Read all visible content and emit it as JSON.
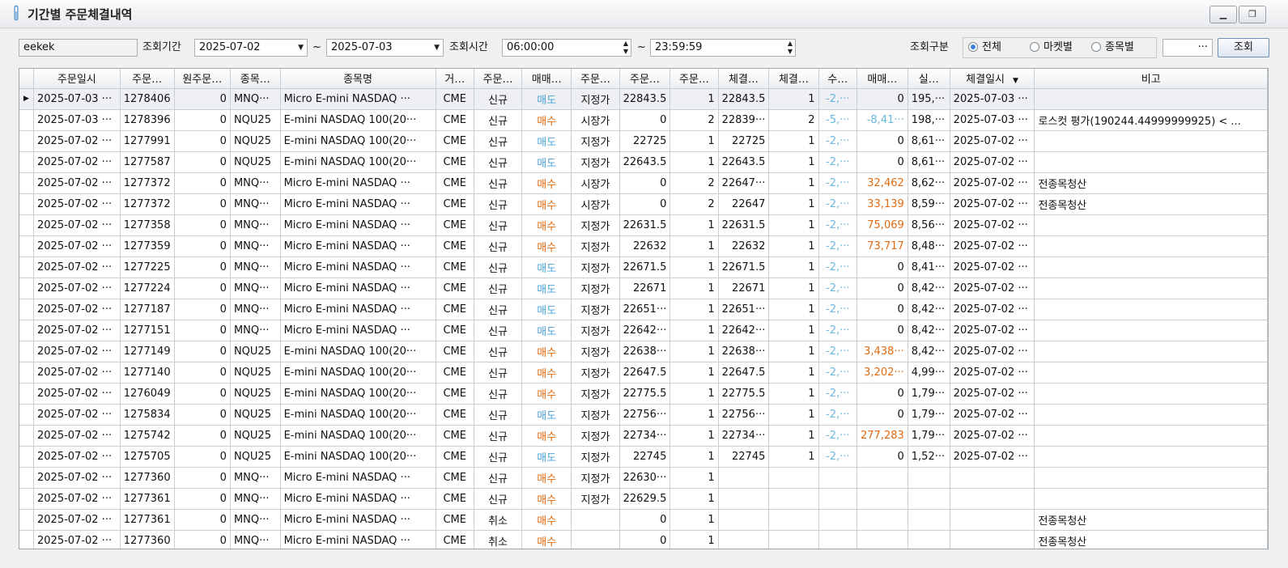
{
  "window": {
    "title": "기간별 주문체결내역",
    "minimize": "▁",
    "restore": "❐"
  },
  "toolbar": {
    "account": "eekek",
    "label_period": "조회기간",
    "date_from": "2025-07-02",
    "tilde": "~",
    "date_to": "2025-07-03",
    "label_time": "조회시간",
    "time_from": "06:00:00",
    "time_to": "23:59:59",
    "label_type": "조회구분",
    "radios": [
      {
        "label": "전체",
        "selected": true
      },
      {
        "label": "마켓별",
        "selected": false
      },
      {
        "label": "종목별",
        "selected": false
      }
    ],
    "symbol_value": "···",
    "search_label": "조회"
  },
  "grid": {
    "columns": [
      "주문일시",
      "주문…",
      "원주문…",
      "종목…",
      "종목명",
      "거…",
      "주문…",
      "매매…",
      "주문…",
      "주문…",
      "주문…",
      "체결…",
      "체결…",
      "수…",
      "매매…",
      "실…",
      "체결일시",
      "비고"
    ],
    "sort_indicator": "▼",
    "row_marker": "▶",
    "colors": {
      "sell": "#4aa3d8",
      "buy": "#e06a12",
      "pnl_pos": "#e06a12",
      "pnl_neg": "#6ab6dc"
    },
    "rows": [
      [
        "2025-07-03 ···",
        "1278406",
        "0",
        "MNQ···",
        "Micro E-mini NASDAQ ···",
        "CME",
        "신규",
        "매도",
        "지정가",
        "22843.5",
        "1",
        "22843.5",
        "1",
        "-2,···",
        "0",
        "195,···",
        "2025-07-03 ···",
        ""
      ],
      [
        "2025-07-03 ···",
        "1278396",
        "0",
        "NQU25",
        "E-mini NASDAQ 100(20···",
        "CME",
        "신규",
        "매수",
        "시장가",
        "0",
        "2",
        "22839···",
        "2",
        "-5,···",
        "-8,41···",
        "198,···",
        "2025-07-03 ···",
        "로스컷 평가(190244.44999999925) < ..."
      ],
      [
        "2025-07-02 ···",
        "1277991",
        "0",
        "NQU25",
        "E-mini NASDAQ 100(20···",
        "CME",
        "신규",
        "매도",
        "지정가",
        "22725",
        "1",
        "22725",
        "1",
        "-2,···",
        "0",
        "8,61···",
        "2025-07-02 ···",
        ""
      ],
      [
        "2025-07-02 ···",
        "1277587",
        "0",
        "NQU25",
        "E-mini NASDAQ 100(20···",
        "CME",
        "신규",
        "매도",
        "지정가",
        "22643.5",
        "1",
        "22643.5",
        "1",
        "-2,···",
        "0",
        "8,61···",
        "2025-07-02 ···",
        ""
      ],
      [
        "2025-07-02 ···",
        "1277372",
        "0",
        "MNQ···",
        "Micro E-mini NASDAQ ···",
        "CME",
        "신규",
        "매수",
        "시장가",
        "0",
        "2",
        "22647···",
        "1",
        "-2,···",
        "32,462",
        "8,62···",
        "2025-07-02 ···",
        "전종목청산"
      ],
      [
        "2025-07-02 ···",
        "1277372",
        "0",
        "MNQ···",
        "Micro E-mini NASDAQ ···",
        "CME",
        "신규",
        "매수",
        "시장가",
        "0",
        "2",
        "22647",
        "1",
        "-2,···",
        "33,139",
        "8,59···",
        "2025-07-02 ···",
        "전종목청산"
      ],
      [
        "2025-07-02 ···",
        "1277358",
        "0",
        "MNQ···",
        "Micro E-mini NASDAQ ···",
        "CME",
        "신규",
        "매수",
        "지정가",
        "22631.5",
        "1",
        "22631.5",
        "1",
        "-2,···",
        "75,069",
        "8,56···",
        "2025-07-02 ···",
        ""
      ],
      [
        "2025-07-02 ···",
        "1277359",
        "0",
        "MNQ···",
        "Micro E-mini NASDAQ ···",
        "CME",
        "신규",
        "매수",
        "지정가",
        "22632",
        "1",
        "22632",
        "1",
        "-2,···",
        "73,717",
        "8,48···",
        "2025-07-02 ···",
        ""
      ],
      [
        "2025-07-02 ···",
        "1277225",
        "0",
        "MNQ···",
        "Micro E-mini NASDAQ ···",
        "CME",
        "신규",
        "매도",
        "지정가",
        "22671.5",
        "1",
        "22671.5",
        "1",
        "-2,···",
        "0",
        "8,41···",
        "2025-07-02 ···",
        ""
      ],
      [
        "2025-07-02 ···",
        "1277224",
        "0",
        "MNQ···",
        "Micro E-mini NASDAQ ···",
        "CME",
        "신규",
        "매도",
        "지정가",
        "22671",
        "1",
        "22671",
        "1",
        "-2,···",
        "0",
        "8,42···",
        "2025-07-02 ···",
        ""
      ],
      [
        "2025-07-02 ···",
        "1277187",
        "0",
        "MNQ···",
        "Micro E-mini NASDAQ ···",
        "CME",
        "신규",
        "매도",
        "지정가",
        "22651···",
        "1",
        "22651···",
        "1",
        "-2,···",
        "0",
        "8,42···",
        "2025-07-02 ···",
        ""
      ],
      [
        "2025-07-02 ···",
        "1277151",
        "0",
        "MNQ···",
        "Micro E-mini NASDAQ ···",
        "CME",
        "신규",
        "매도",
        "지정가",
        "22642···",
        "1",
        "22642···",
        "1",
        "-2,···",
        "0",
        "8,42···",
        "2025-07-02 ···",
        ""
      ],
      [
        "2025-07-02 ···",
        "1277149",
        "0",
        "NQU25",
        "E-mini NASDAQ 100(20···",
        "CME",
        "신규",
        "매수",
        "지정가",
        "22638···",
        "1",
        "22638···",
        "1",
        "-2,···",
        "3,438···",
        "8,42···",
        "2025-07-02 ···",
        ""
      ],
      [
        "2025-07-02 ···",
        "1277140",
        "0",
        "NQU25",
        "E-mini NASDAQ 100(20···",
        "CME",
        "신규",
        "매수",
        "지정가",
        "22647.5",
        "1",
        "22647.5",
        "1",
        "-2,···",
        "3,202···",
        "4,99···",
        "2025-07-02 ···",
        ""
      ],
      [
        "2025-07-02 ···",
        "1276049",
        "0",
        "NQU25",
        "E-mini NASDAQ 100(20···",
        "CME",
        "신규",
        "매수",
        "지정가",
        "22775.5",
        "1",
        "22775.5",
        "1",
        "-2,···",
        "0",
        "1,79···",
        "2025-07-02 ···",
        ""
      ],
      [
        "2025-07-02 ···",
        "1275834",
        "0",
        "NQU25",
        "E-mini NASDAQ 100(20···",
        "CME",
        "신규",
        "매도",
        "지정가",
        "22756···",
        "1",
        "22756···",
        "1",
        "-2,···",
        "0",
        "1,79···",
        "2025-07-02 ···",
        ""
      ],
      [
        "2025-07-02 ···",
        "1275742",
        "0",
        "NQU25",
        "E-mini NASDAQ 100(20···",
        "CME",
        "신규",
        "매수",
        "지정가",
        "22734···",
        "1",
        "22734···",
        "1",
        "-2,···",
        "277,283",
        "1,79···",
        "2025-07-02 ···",
        ""
      ],
      [
        "2025-07-02 ···",
        "1275705",
        "0",
        "NQU25",
        "E-mini NASDAQ 100(20···",
        "CME",
        "신규",
        "매도",
        "지정가",
        "22745",
        "1",
        "22745",
        "1",
        "-2,···",
        "0",
        "1,52···",
        "2025-07-02 ···",
        ""
      ],
      [
        "2025-07-02 ···",
        "1277360",
        "0",
        "MNQ···",
        "Micro E-mini NASDAQ ···",
        "CME",
        "신규",
        "매수",
        "지정가",
        "22630···",
        "1",
        "",
        "",
        "",
        "",
        "",
        "",
        ""
      ],
      [
        "2025-07-02 ···",
        "1277361",
        "0",
        "MNQ···",
        "Micro E-mini NASDAQ ···",
        "CME",
        "신규",
        "매수",
        "지정가",
        "22629.5",
        "1",
        "",
        "",
        "",
        "",
        "",
        "",
        ""
      ],
      [
        "2025-07-02 ···",
        "1277361",
        "0",
        "MNQ···",
        "Micro E-mini NASDAQ ···",
        "CME",
        "취소",
        "매수",
        "",
        "0",
        "1",
        "",
        "",
        "",
        "",
        "",
        "",
        "전종목청산"
      ],
      [
        "2025-07-02 ···",
        "1277360",
        "0",
        "MNQ···",
        "Micro E-mini NASDAQ ···",
        "CME",
        "취소",
        "매수",
        "",
        "0",
        "1",
        "",
        "",
        "",
        "",
        "",
        "",
        "전종목청산"
      ]
    ]
  }
}
